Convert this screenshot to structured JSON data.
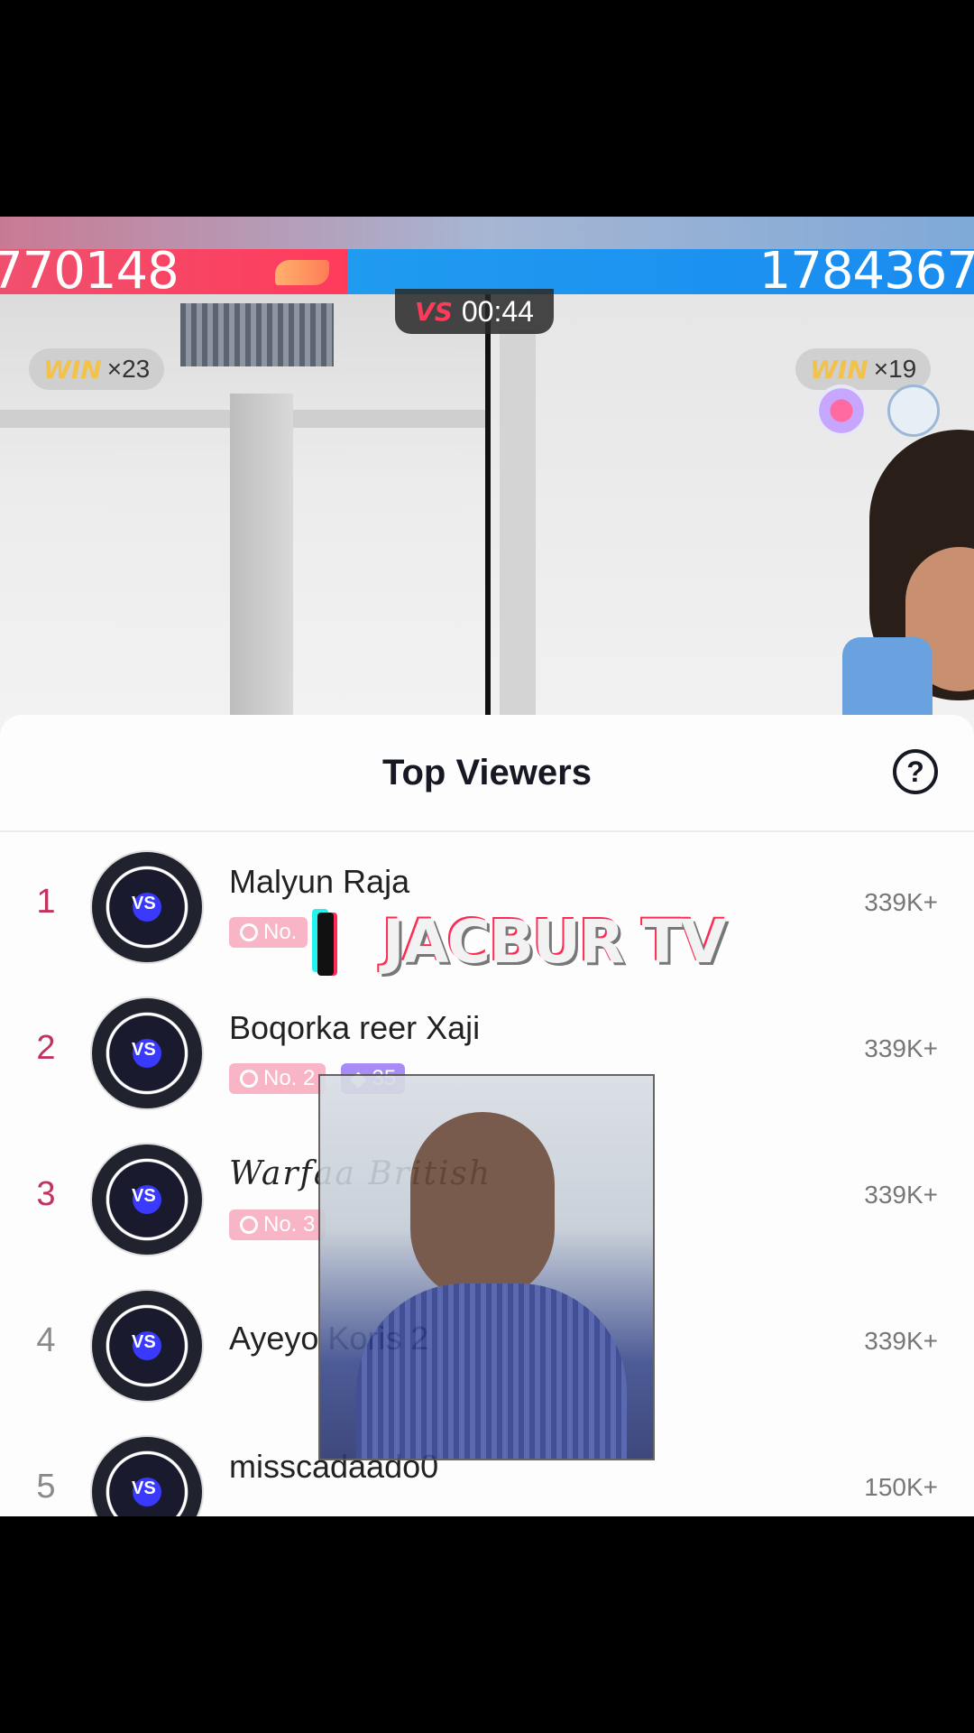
{
  "battle": {
    "left_score": "770148",
    "right_score": "1784367",
    "timer": "00:44",
    "vs_label": "VS",
    "left_win_label": "WIN",
    "left_win_count": "×23",
    "right_win_label": "WIN",
    "right_win_count": "×19"
  },
  "sheet": {
    "title": "Top Viewers",
    "help_glyph": "?"
  },
  "viewers": [
    {
      "rank": "1",
      "name": "Malyun Raja",
      "badge": "No.",
      "level": "",
      "score": "339K+"
    },
    {
      "rank": "2",
      "name": "Boqorka  reer  Xaji",
      "badge": "No. 2",
      "level": "35",
      "score": "339K+"
    },
    {
      "rank": "3",
      "name": "Warfaa British",
      "badge": "No. 3",
      "level": "",
      "score": "339K+"
    },
    {
      "rank": "4",
      "name": "Ayeyo Koris 2",
      "badge": "",
      "level": "",
      "score": "339K+"
    },
    {
      "rank": "5",
      "name": "misscadaado0",
      "badge": "",
      "level": "",
      "score": "150K+"
    }
  ],
  "watermark": {
    "text": "JACBUR TV"
  },
  "colors": {
    "rank_top": "#c0335d",
    "rank_other": "#8a8a8a",
    "left_team": "#ff3b5c",
    "right_team": "#1a8cf0"
  }
}
